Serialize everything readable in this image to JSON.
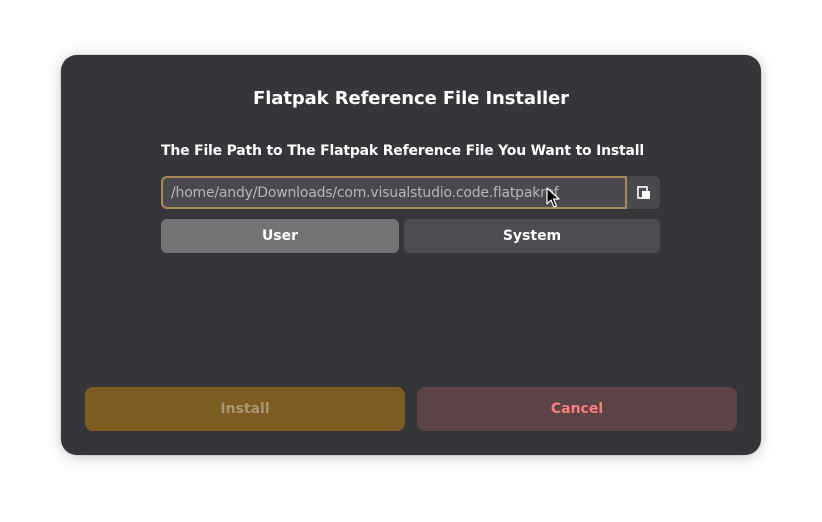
{
  "dialog": {
    "title": "Flatpak Reference File Installer",
    "field_label": "The File Path to The Flatpak Reference File You Want to Install",
    "path_value": "/home/andy/Downloads/com.visualstudio.code.flatpakref",
    "browse_icon": "document-open-icon",
    "scope": {
      "user_label": "User",
      "system_label": "System",
      "selected": "User"
    },
    "actions": {
      "install_label": "Install",
      "cancel_label": "Cancel"
    }
  },
  "colors": {
    "dialog_bg": "#36363a",
    "input_focus_border": "#a98a55",
    "install_bg": "#7b5d22",
    "cancel_bg": "#5c4346",
    "cancel_text": "#ff7b7b"
  }
}
